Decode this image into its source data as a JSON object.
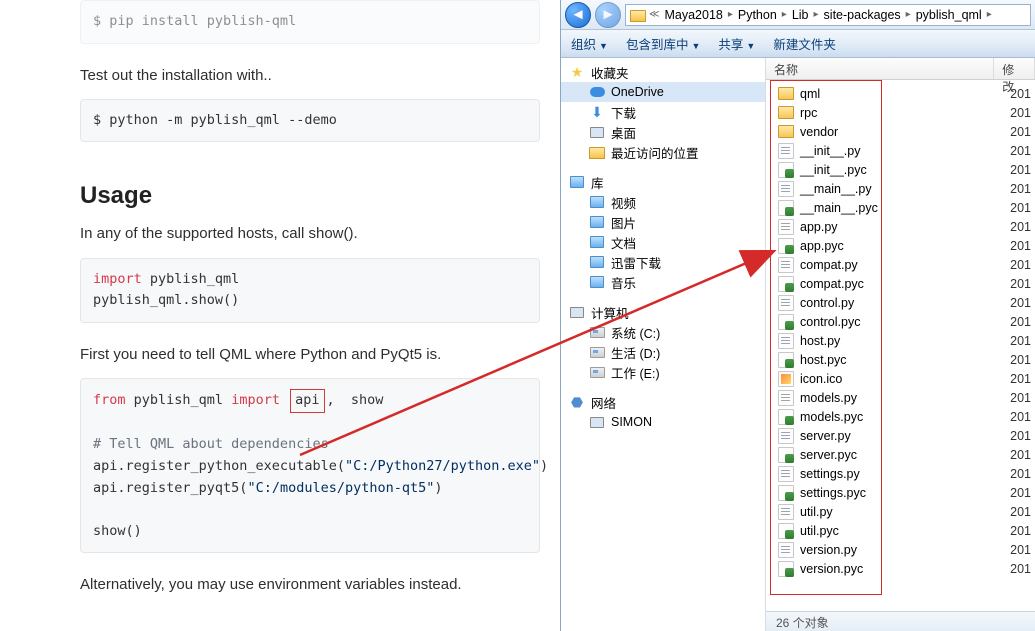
{
  "doc": {
    "pip_line": "$ pip install pyblish-qml",
    "test_line": "Test out the installation with..",
    "demo_line": "$ python -m pyblish_qml --demo",
    "usage_h": "Usage",
    "usage_p": "In any of the supported hosts, call show().",
    "code1_l1_kw": "import",
    "code1_l1_rest": " pyblish_qml",
    "code1_l2": "pyblish_qml.show()",
    "first_p": "First you need to tell QML where Python and PyQt5 is.",
    "code2_l1_kw": "from",
    "code2_l1_a": " pyblish_qml ",
    "code2_l1_kw2": "import",
    "code2_l1_api": "api",
    "code2_l1_rest": ",  show",
    "code2_c": "# Tell QML about dependencies",
    "code2_l3a": "api.register_python_executable(",
    "code2_l3s": "\"C:/Python27/python.exe\"",
    "code2_l3b": ")",
    "code2_l4a": "api.register_pyqt5(",
    "code2_l4s": "\"C:/modules/python-qt5\"",
    "code2_l4b": ")",
    "code2_l5": "show()",
    "alt_p": "Alternatively, you may use environment variables instead."
  },
  "breadcrumb": [
    "Maya2018",
    "Python",
    "Lib",
    "site-packages",
    "pyblish_qml"
  ],
  "toolbar": {
    "organize": "组织",
    "include": "包含到库中",
    "share": "共享",
    "newfolder": "新建文件夹"
  },
  "tree": {
    "fav": "收藏夹",
    "onedrive": "OneDrive",
    "downloads": "下载",
    "desktop": "桌面",
    "recent": "最近访问的位置",
    "libraries": "库",
    "videos": "视频",
    "pictures": "图片",
    "documents": "文档",
    "xunlei": "迅雷下载",
    "music": "音乐",
    "computer": "计算机",
    "drive_c": "系统 (C:)",
    "drive_d": "生活 (D:)",
    "drive_e": "工作 (E:)",
    "network": "网络",
    "simon": "SIMON"
  },
  "columns": {
    "name": "名称",
    "mod": "修改"
  },
  "date_stub": "201",
  "files": [
    {
      "icon": "folder",
      "name": "qml"
    },
    {
      "icon": "folder",
      "name": "rpc"
    },
    {
      "icon": "folder",
      "name": "vendor"
    },
    {
      "icon": "txtfile",
      "name": "__init__.py"
    },
    {
      "icon": "pyfile",
      "name": "__init__.pyc"
    },
    {
      "icon": "txtfile",
      "name": "__main__.py"
    },
    {
      "icon": "pyfile",
      "name": "__main__.pyc"
    },
    {
      "icon": "txtfile",
      "name": "app.py"
    },
    {
      "icon": "pyfile",
      "name": "app.pyc"
    },
    {
      "icon": "txtfile",
      "name": "compat.py"
    },
    {
      "icon": "pyfile",
      "name": "compat.pyc"
    },
    {
      "icon": "txtfile",
      "name": "control.py"
    },
    {
      "icon": "pyfile",
      "name": "control.pyc"
    },
    {
      "icon": "txtfile",
      "name": "host.py"
    },
    {
      "icon": "pyfile",
      "name": "host.pyc"
    },
    {
      "icon": "icoimg",
      "name": "icon.ico"
    },
    {
      "icon": "txtfile",
      "name": "models.py"
    },
    {
      "icon": "pyfile",
      "name": "models.pyc"
    },
    {
      "icon": "txtfile",
      "name": "server.py"
    },
    {
      "icon": "pyfile",
      "name": "server.pyc"
    },
    {
      "icon": "txtfile",
      "name": "settings.py"
    },
    {
      "icon": "pyfile",
      "name": "settings.pyc"
    },
    {
      "icon": "txtfile",
      "name": "util.py"
    },
    {
      "icon": "pyfile",
      "name": "util.pyc"
    },
    {
      "icon": "txtfile",
      "name": "version.py"
    },
    {
      "icon": "pyfile",
      "name": "version.pyc"
    }
  ],
  "status": "26 个对象"
}
